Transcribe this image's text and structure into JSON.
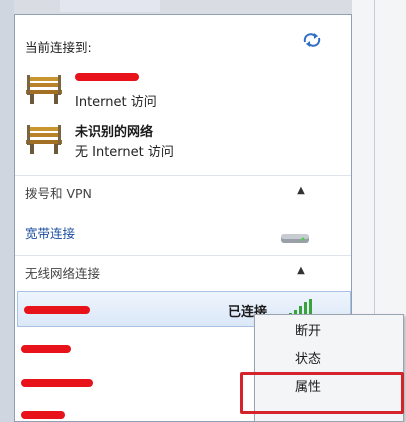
{
  "header": {
    "title": "当前连接到:"
  },
  "connected_networks": [
    {
      "name": "",
      "status": "Internet 访问"
    },
    {
      "name": "未识别的网络",
      "status": "无 Internet 访问"
    }
  ],
  "sections": {
    "dialup_vpn": {
      "label": "拨号和 VPN",
      "items": [
        {
          "label": "宽带连接"
        }
      ]
    },
    "wireless": {
      "label": "无线网络连接",
      "active": {
        "status": "已连接"
      }
    }
  },
  "context_menu": {
    "items": [
      {
        "label": "断开"
      },
      {
        "label": "状态"
      },
      {
        "label": "属性"
      }
    ]
  },
  "colors": {
    "accent": "#1a4f9f",
    "redact": "#e8121b",
    "highlight": "#d4232b"
  },
  "icons": {
    "refresh": "refresh-icon",
    "network": "bench-icon",
    "signal": "wifi-signal-icon",
    "broadband": "broadband-icon"
  }
}
